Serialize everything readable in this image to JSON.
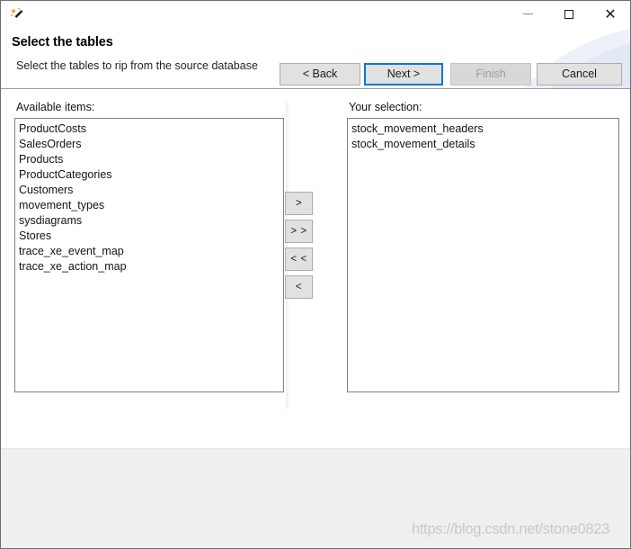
{
  "window": {
    "icon": "magic-wand-icon",
    "controls": {
      "minimize": "minimize-icon",
      "maximize": "maximize-icon",
      "close": "close-icon"
    }
  },
  "header": {
    "title": "Select the tables",
    "subtitle": "Select the tables to rip from the source database"
  },
  "panels": {
    "available": {
      "label": "Available items:",
      "items": [
        "ProductCosts",
        "SalesOrders",
        "Products",
        "ProductCategories",
        "Customers",
        "movement_types",
        "sysdiagrams",
        "Stores",
        "trace_xe_event_map",
        "trace_xe_action_map"
      ]
    },
    "selection": {
      "label": "Your selection:",
      "items": [
        "stock_movement_headers",
        "stock_movement_details"
      ]
    }
  },
  "transfer_buttons": [
    {
      "label": ">",
      "name": "move-right-button"
    },
    {
      "label": "> >",
      "name": "move-all-right-button"
    },
    {
      "label": "< <",
      "name": "move-all-left-button"
    },
    {
      "label": "<",
      "name": "move-left-button"
    }
  ],
  "footer": {
    "back": "< Back",
    "next": "Next >",
    "finish": "Finish",
    "cancel": "Cancel"
  },
  "watermark": "https://blog.csdn.net/stone0823",
  "colors": {
    "focus_accent": "#0078d7",
    "button_face": "#e1e1e1",
    "footer_bg": "#efefef",
    "disabled_text": "#9d9d9d"
  }
}
